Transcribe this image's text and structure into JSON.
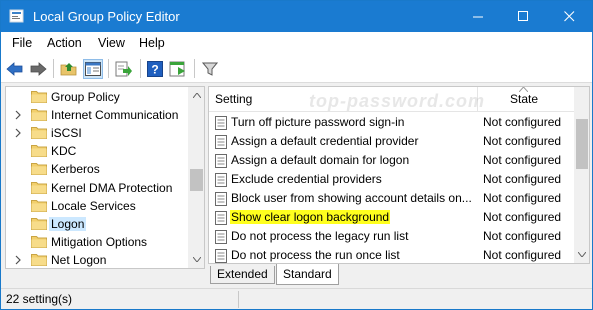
{
  "window": {
    "title": "Local Group Policy Editor"
  },
  "menu": {
    "items": [
      "File",
      "Action",
      "View",
      "Help"
    ]
  },
  "toolbar": {
    "icons": [
      "back-icon",
      "forward-icon",
      "up-folder-icon",
      "show-hide-tree-icon",
      "export-list-icon",
      "help-icon",
      "properties-icon",
      "filter-icon"
    ]
  },
  "tree": {
    "items": [
      {
        "label": "Group Policy",
        "expandable": false
      },
      {
        "label": "Internet Communication",
        "expandable": true
      },
      {
        "label": "iSCSI",
        "expandable": true
      },
      {
        "label": "KDC",
        "expandable": false
      },
      {
        "label": "Kerberos",
        "expandable": false
      },
      {
        "label": "Kernel DMA Protection",
        "expandable": false
      },
      {
        "label": "Locale Services",
        "expandable": false
      },
      {
        "label": "Logon",
        "expandable": false,
        "selected": true
      },
      {
        "label": "Mitigation Options",
        "expandable": false
      },
      {
        "label": "Net Logon",
        "expandable": true
      }
    ]
  },
  "list": {
    "col_setting": "Setting",
    "col_state": "State",
    "watermark": "top-password.com",
    "rows": [
      {
        "name": "Turn off picture password sign-in",
        "state": "Not configured"
      },
      {
        "name": "Assign a default credential provider",
        "state": "Not configured"
      },
      {
        "name": "Assign a default domain for logon",
        "state": "Not configured"
      },
      {
        "name": "Exclude credential providers",
        "state": "Not configured"
      },
      {
        "name": "Block user from showing account details on...",
        "state": "Not configured"
      },
      {
        "name": "Show clear logon background",
        "state": "Not configured",
        "highlight": true
      },
      {
        "name": "Do not process the legacy run list",
        "state": "Not configured"
      },
      {
        "name": "Do not process the run once list",
        "state": "Not configured"
      }
    ]
  },
  "tabs": {
    "extended": "Extended",
    "standard": "Standard",
    "active": "Standard"
  },
  "status": {
    "text": "22 setting(s)"
  },
  "colors": {
    "titlebar": "#1a7bd1",
    "highlight": "#ffff1e",
    "selection": "#cce8ff"
  }
}
